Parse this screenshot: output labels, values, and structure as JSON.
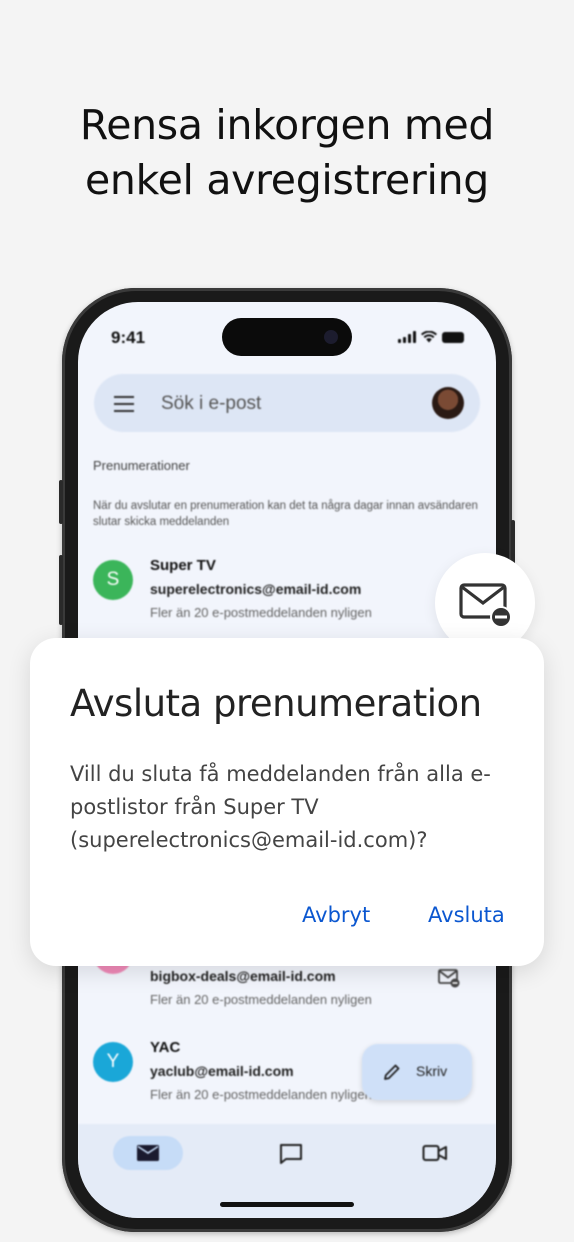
{
  "headline": {
    "line1": "Rensa inkorgen med",
    "line2": "enkel avregistrering"
  },
  "status_bar": {
    "time": "9:41"
  },
  "search": {
    "placeholder": "Sök i e-post"
  },
  "subscriptions": {
    "section_title": "Prenumerationer",
    "note": "När du avslutar en prenumeration kan det ta några dagar innan avsändaren slutar skicka meddelanden",
    "items": [
      {
        "initial": "S",
        "sender": "Super TV",
        "address": "superelectronics@email-id.com",
        "meta": "Fler än 20 e-postmeddelanden nyligen",
        "avatar_color": "#3bb55a"
      },
      {
        "initial": "B",
        "sender": "",
        "address": "bigbox-deals@email-id.com",
        "meta": "Fler än 20 e-postmeddelanden nyligen",
        "avatar_color": "#f08ab8"
      },
      {
        "initial": "Y",
        "sender": "YAC",
        "address": "yaclub@email-id.com",
        "meta": "Fler än 20 e-postmeddelanden nyligen",
        "avatar_color": "#1aa7d8"
      }
    ]
  },
  "compose": {
    "label": "Skriv"
  },
  "dialog": {
    "title": "Avsluta prenumeration",
    "body": "Vill du sluta få meddelanden från alla e-postlistor från Super TV (superelectronics@email-id.com)?",
    "cancel_label": "Avbryt",
    "confirm_label": "Avsluta"
  },
  "colors": {
    "accent": "#0b57d0",
    "background": "#f4f4f4",
    "screen": "#f2f5fc"
  },
  "icons": [
    "menu-icon",
    "unsubscribe-mail-icon",
    "pencil-icon",
    "mail-icon",
    "chat-icon",
    "video-icon"
  ]
}
